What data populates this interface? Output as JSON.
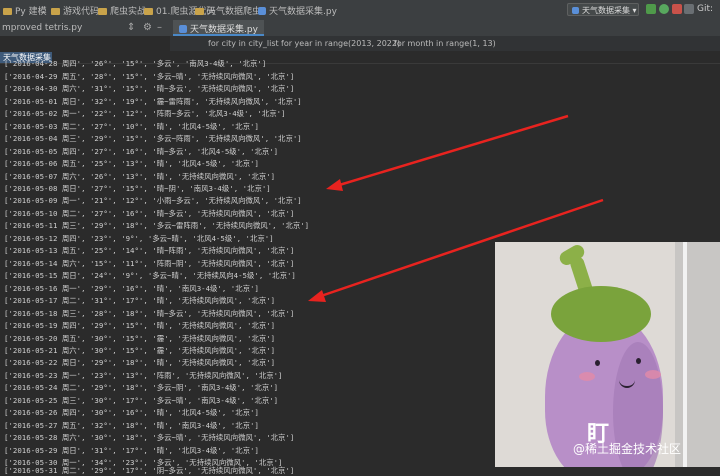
{
  "titlebar": {
    "items": [
      {
        "label": "Py 建模",
        "icon": "folder-icon"
      },
      {
        "label": "游戏代码",
        "icon": "folder-icon"
      },
      {
        "label": "爬虫实战",
        "icon": "folder-icon"
      },
      {
        "label": "01.爬虫源代码",
        "icon": "folder-icon"
      },
      {
        "label": "天气数据爬虫",
        "icon": "folder-icon"
      },
      {
        "label": "天气数据采集.py",
        "icon": "python-file-icon"
      }
    ],
    "run_config": "天气数据采集",
    "git_label": "Git:"
  },
  "project": {
    "file": "mproved tetris.py"
  },
  "editor": {
    "tab": "天气数据采集.py",
    "breadcrumbs": [
      "for city in city_list",
      "for year in range(2013, 2022)",
      "for month in range(1, 13)"
    ]
  },
  "run": {
    "tab": "天气数据采集"
  },
  "console": {
    "lines": [
      "['2016-04-28 周四', '26°', '15°', '多云', '南风3-4级', '北京']",
      "['2016-04-29 周五', '28°', '15°', '多云~晴', '无持续风向微风', '北京']",
      "['2016-04-30 周六', '31°', '15°', '晴~多云', '无持续风向微风', '北京']",
      "['2016-05-01 周日', '32°', '19°', '霾~雷阵雨', '无持续风向微风', '北京']",
      "['2016-05-02 周一', '22°', '12°', '阵雨~多云', '北风3-4级', '北京']",
      "['2016-05-03 周二', '27°', '10°', '晴', '北风4-5级', '北京']",
      "['2016-05-04 周三', '29°', '15°', '多云~阵雨', '无持续风向微风', '北京']",
      "['2016-05-05 周四', '27°', '16°', '晴~多云', '北风4-5级', '北京']",
      "['2016-05-06 周五', '25°', '13°', '晴', '北风4-5级', '北京']",
      "['2016-05-07 周六', '26°', '13°', '晴', '无持续风向微风', '北京']",
      "['2016-05-08 周日', '27°', '15°', '晴~阴', '南风3-4级', '北京']",
      "['2016-05-09 周一', '21°', '12°', '小雨~多云', '无持续风向微风', '北京']",
      "['2016-05-10 周二', '27°', '16°', '晴~多云', '无持续风向微风', '北京']",
      "['2016-05-11 周三', '29°', '18°', '多云~雷阵雨', '无持续风向微风', '北京']",
      "['2016-05-12 周四', '23°', '9°', '多云~晴', '北风4-5级', '北京']",
      "['2016-05-13 周五', '25°', '14°', '晴~阵雨', '无持续风向微风', '北京']",
      "['2016-05-14 周六', '15°', '11°', '阵雨~阴', '无持续风向微风', '北京']",
      "['2016-05-15 周日', '24°', '9°', '多云~晴', '无持续风向4-5级', '北京']",
      "['2016-05-16 周一', '29°', '16°', '晴', '南风3-4级', '北京']",
      "['2016-05-17 周二', '31°', '17°', '晴', '无持续风向微风', '北京']",
      "['2016-05-18 周三', '28°', '18°', '晴~多云', '无持续风向微风', '北京']",
      "['2016-05-19 周四', '29°', '15°', '晴', '无持续风向微风', '北京']",
      "['2016-05-20 周五', '30°', '15°', '霾', '无持续风向微风', '北京']",
      "['2016-05-21 周六', '30°', '15°', '霾', '无持续风向微风', '北京']",
      "['2016-05-22 周日', '29°', '18°', '晴', '无持续风向微风', '北京']",
      "['2016-05-23 周一', '23°', '13°', '阵雨', '无持续风向微风', '北京']",
      "['2016-05-24 周二', '29°', '18°', '多云~阴', '南风3-4级', '北京']",
      "['2016-05-25 周三', '30°', '17°', '多云~晴', '南风3-4级', '北京']",
      "['2016-05-26 周四', '30°', '16°', '晴', '北风4-5级', '北京']",
      "['2016-05-27 周五', '32°', '18°', '晴', '南风3-4级', '北京']",
      "['2016-05-28 周六', '30°', '18°', '多云~晴', '无持续风向微风', '北京']",
      "['2016-05-29 周日', '31°', '17°', '晴', '北风3-4级', '北京']",
      "['2016-05-30 周一', '34°', '23°', '多云', '无持续风向微风', '北京']",
      "['2016-05-31 周二', '29°', '17°', '阴~多云', '无持续风向微风', '北京']"
    ]
  },
  "photo": {
    "caption": "盯",
    "watermark": "@稀土掘金技术社区"
  },
  "colors": {
    "arrow": "#e8231f",
    "editor_bg": "#2b2b2b",
    "toolbar_bg": "#3c3f41"
  }
}
